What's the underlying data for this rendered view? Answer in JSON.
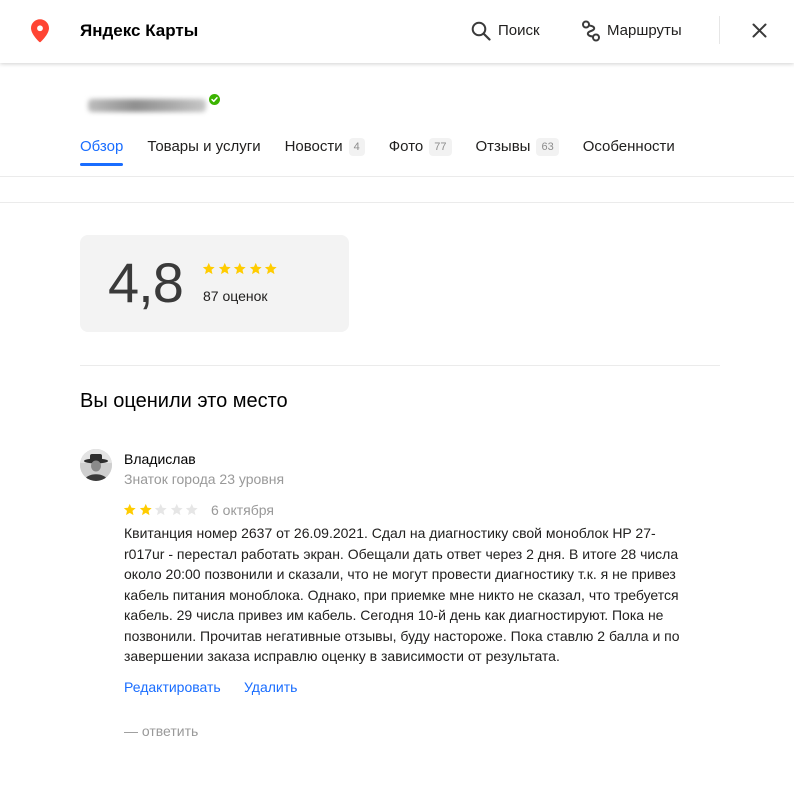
{
  "header": {
    "app_title": "Яндекс Карты",
    "search_label": "Поиск",
    "routes_label": "Маршруты",
    "icons": [
      "map-pin-icon",
      "search-icon",
      "routes-icon",
      "close-icon"
    ]
  },
  "org": {
    "verified_icon": "verified-check-icon"
  },
  "tabs": [
    {
      "label": "Обзор",
      "active": true
    },
    {
      "label": "Товары и услуги"
    },
    {
      "label": "Новости",
      "count": "4"
    },
    {
      "label": "Фото",
      "count": "77"
    },
    {
      "label": "Отзывы",
      "count": "63"
    },
    {
      "label": "Особенности"
    }
  ],
  "rating_summary": {
    "value": "4,8",
    "stars_filled": 5,
    "stars_total": 5,
    "count_label": "87 оценок"
  },
  "my_review": {
    "heading": "Вы оценили это место",
    "author": "Владислав",
    "author_level": "Знаток города 23 уровня",
    "rating": 2,
    "max_rating": 5,
    "date": "6 октября",
    "text_lines": [
      "Квитанция номер 2637 от 26.09.2021. Сдал на диагностику свой моноблок HP 27-",
      "r017ur - перестал работать экран. Обещали дать ответ через 2 дня. В итоге 28 числа",
      "около 20:00 позвонили и сказали, что не могут провести диагностику т.к. я не привез",
      "кабель питания моноблока. Однако, при приемке мне никто не сказал, что требуется",
      "кабель. 29 числа привез им кабель. Сегодня 10-й день как диагностируют. Пока не",
      "позвонили. Прочитав негативные отзывы, буду настороже. Пока ставлю 2 балла и по",
      "завершении заказа исправлю оценку в зависимости от результата."
    ],
    "edit_label": "Редактировать",
    "delete_label": "Удалить",
    "reply_label": "— ответить"
  },
  "colors": {
    "accent": "#196dff",
    "star_filled": "#fc0",
    "star_empty": "#e6e6e6",
    "pin": "#f43",
    "verified": "#3bb300"
  }
}
